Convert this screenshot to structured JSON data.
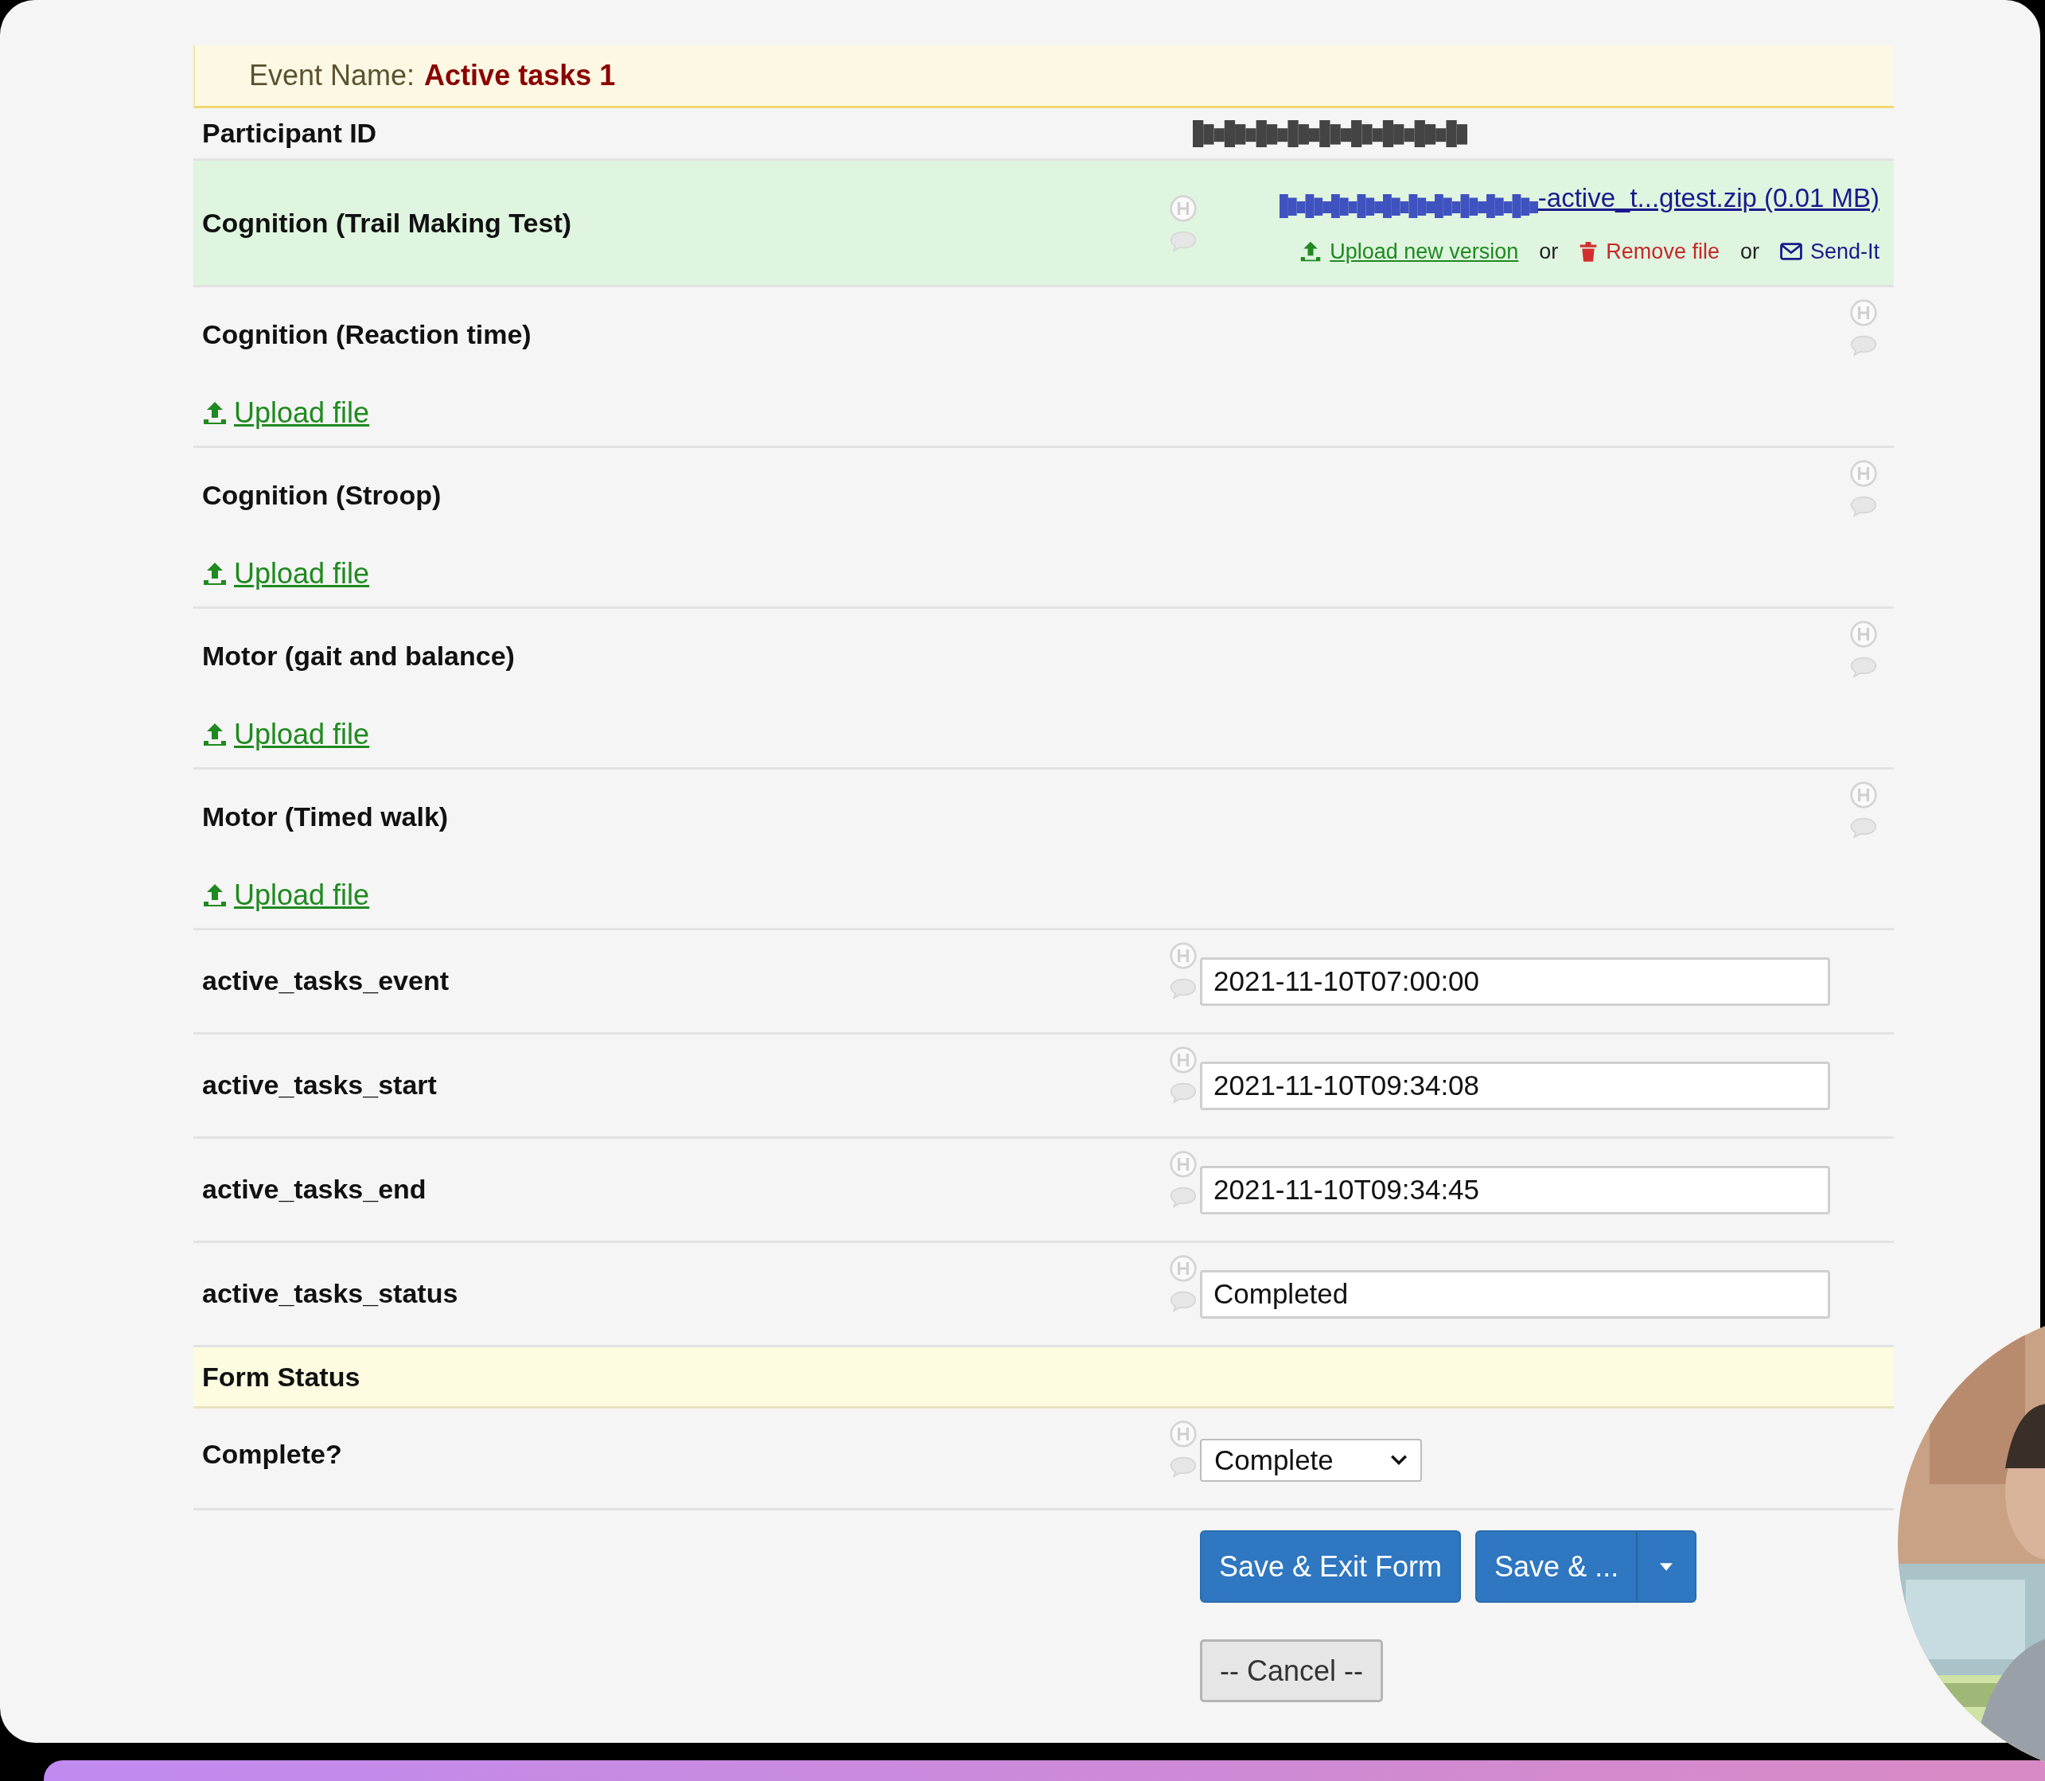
{
  "event": {
    "label": "Event Name:",
    "value": "Active tasks 1"
  },
  "fields": [
    {
      "kind": "id",
      "label": "Participant ID"
    },
    {
      "kind": "file_uploaded",
      "label": "Cognition (Trail Making Test)",
      "file": "-active_t...gtest.zip (0.01 MB)",
      "actions": [
        {
          "kind": "upload",
          "label": "Upload new version"
        },
        {
          "kind": "or",
          "label": "or"
        },
        {
          "kind": "remove",
          "label": "Remove file"
        },
        {
          "kind": "or",
          "label": "or"
        },
        {
          "kind": "send",
          "label": "Send-It"
        }
      ]
    },
    {
      "kind": "file_empty",
      "label": "Cognition (Reaction time)",
      "link": "Upload file"
    },
    {
      "kind": "file_empty",
      "label": "Cognition (Stroop)",
      "link": "Upload file"
    },
    {
      "kind": "file_empty",
      "label": "Motor (gait and balance)",
      "link": "Upload file"
    },
    {
      "kind": "file_empty",
      "label": "Motor (Timed walk)",
      "link": "Upload file"
    },
    {
      "kind": "text",
      "label": "active_tasks_event",
      "value": "2021-11-10T07:00:00"
    },
    {
      "kind": "text",
      "label": "active_tasks_start",
      "value": "2021-11-10T09:34:08"
    },
    {
      "kind": "text",
      "label": "active_tasks_end",
      "value": "2021-11-10T09:34:45"
    },
    {
      "kind": "text",
      "label": "active_tasks_status",
      "value": "Completed"
    },
    {
      "kind": "section",
      "label": "Form Status"
    },
    {
      "kind": "select",
      "label": "Complete?",
      "value": "Complete"
    }
  ],
  "buttons": [
    {
      "kind": "primary",
      "label": "Save & Exit Form"
    },
    {
      "kind": "split",
      "label": "Save & ..."
    },
    {
      "kind": "secondary",
      "label": "-- Cancel --"
    }
  ]
}
